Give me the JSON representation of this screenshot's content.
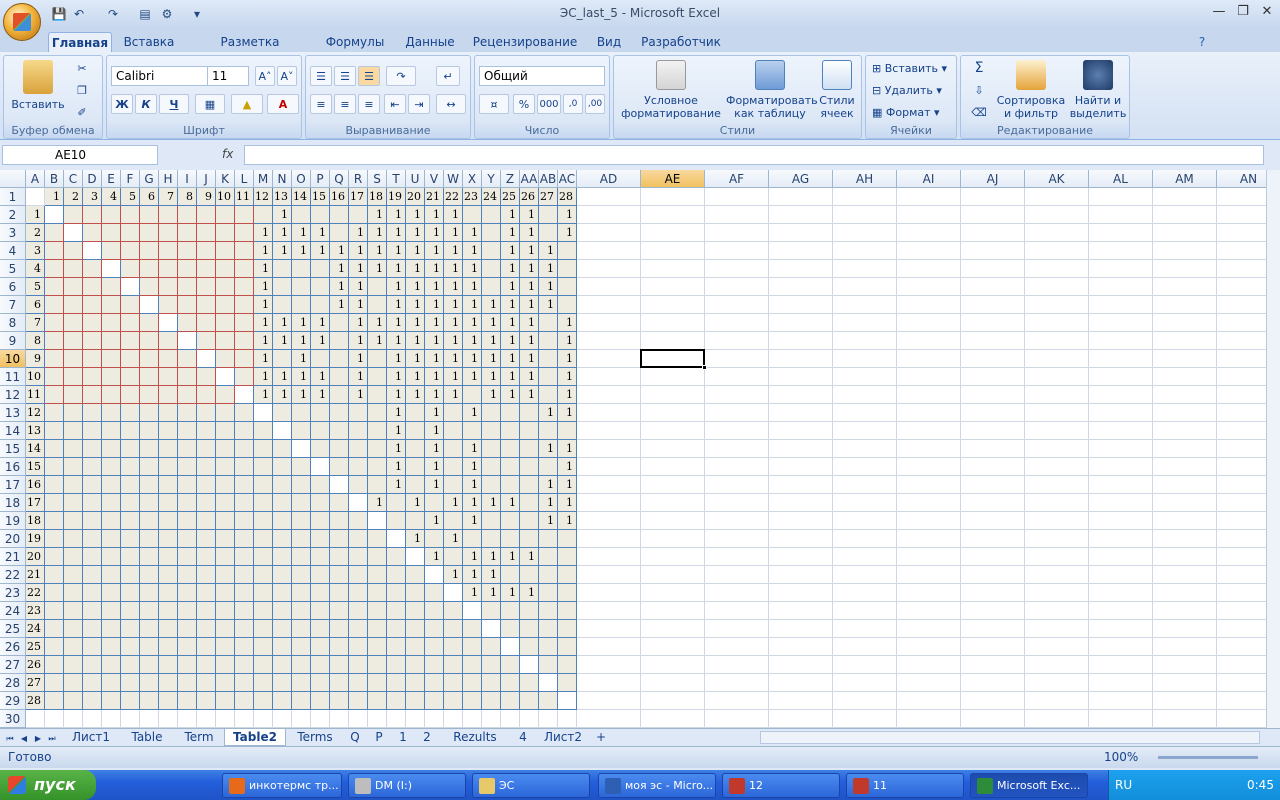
{
  "window": {
    "title": "ЭС_last_5 - Microsoft Excel"
  },
  "ribbon_tabs": [
    "Главная",
    "Вставка",
    "Разметка страницы",
    "Формулы",
    "Данные",
    "Рецензирование",
    "Вид",
    "Разработчик"
  ],
  "ribbon": {
    "paste_label": "Вставить",
    "clipboard_label": "Буфер обмена",
    "font_name": "Calibri",
    "font_size": "11",
    "bold": "Ж",
    "italic": "К",
    "underline": "Ч",
    "font_label": "Шрифт",
    "align_label": "Выравнивание",
    "number_format": "Общий",
    "number_label": "Число",
    "cond_format": "Условное форматирование",
    "format_table": "Форматировать как таблицу",
    "cell_styles": "Стили ячеек",
    "styles_label": "Стили",
    "insert": "Вставить",
    "delete": "Удалить",
    "format": "Формат",
    "cells_label": "Ячейки",
    "sort_filter": "Сортировка и фильтр",
    "find_select": "Найти и выделить",
    "editing_label": "Редактирование"
  },
  "formula_bar": {
    "name_box": "AE10",
    "fx": "fx",
    "formula": ""
  },
  "columns": [
    "A",
    "B",
    "C",
    "D",
    "E",
    "F",
    "G",
    "H",
    "I",
    "J",
    "K",
    "L",
    "M",
    "N",
    "O",
    "P",
    "Q",
    "R",
    "S",
    "T",
    "U",
    "V",
    "W",
    "X",
    "Y",
    "Z",
    "AA",
    "AB",
    "AC",
    "AD",
    "AE",
    "AF",
    "AG",
    "AH",
    "AI",
    "AJ",
    "AK",
    "AL",
    "AM",
    "AN"
  ],
  "row_numbers": [
    "1",
    "2",
    "3",
    "4",
    "5",
    "6",
    "7",
    "8",
    "9",
    "10",
    "11",
    "12",
    "13",
    "14",
    "15",
    "16",
    "17",
    "18",
    "19",
    "20",
    "21",
    "22",
    "23",
    "24",
    "25",
    "26",
    "27",
    "28",
    "29",
    "30"
  ],
  "grid": {
    "rows": [
      "1 2 3 4 5 6 7 8 9 10 11 12 13 14 15 16 17 18 19 20 21 22 23 24 25 26 27 28",
      "12:1|17:1|18:1|19:1|20:1|21:1|24:1|25:1|27:1",
      "11:1|12:1|13:1|14:1|16:1|17:1|18:1|19:1|20:1|21:1|22:1|24:1|25:1|27:1",
      "11:1|12:1|13:1|14:1|15:1|16:1|17:1|18:1|19:1|20:1|21:1|22:1|24:1|25:1|26:1",
      "11:1|15:1|16:1|17:1|18:1|19:1|20:1|21:1|22:1|24:1|25:1|26:1",
      "11:1|15:1|16:1|18:1|19:1|20:1|21:1|22:1|24:1|25:1|26:1",
      "11:1|15:1|16:1|18:1|19:1|20:1|21:1|22:1|23:1|24:1|25:1|26:1",
      "11:1|12:1|13:1|14:1|16:1|17:1|18:1|19:1|20:1|21:1|22:1|23:1|24:1|25:1|27:1",
      "11:1|12:1|13:1|14:1|16:1|17:1|18:1|19:1|20:1|21:1|22:1|23:1|24:1|25:1|27:1",
      "11:1|13:1|16:1|18:1|19:1|20:1|21:1|22:1|23:1|24:1|25:1|27:1",
      "11:1|12:1|13:1|14:1|16:1|18:1|19:1|20:1|21:1|22:1|23:1|24:1|25:1|27:1",
      "11:1|12:1|13:1|14:1|16:1|18:1|19:1|20:1|21:1|23:1|24:1|25:1|27:1",
      "18:1|20:1|22:1|26:1|27:1",
      "18:1|20:1",
      "18:1|20:1|22:1|26:1|27:1",
      "18:1|20:1|22:1|27:1",
      "18:1|20:1|22:1|26:1|27:1",
      "17:1|19:1|21:1|22:1|23:1|24:1|26:1|27:1",
      "20:1|22:1|26:1|27:1",
      "19:1|21:1",
      "20:1|22:1|23:1|24:1|25:1",
      "21:1|22:1|23:1",
      "22:1|23:1|24:1|25:1",
      "",
      "",
      "",
      "",
      ""
    ]
  },
  "sheet_tabs": [
    "Лист1",
    "Table",
    "Term",
    "Table2",
    "Terms",
    "Q",
    "P",
    "1",
    "2",
    "Rezults",
    "4",
    "Лист2"
  ],
  "active_sheet": "Table2",
  "status": {
    "ready": "Готово",
    "zoom": "100%"
  },
  "taskbar": {
    "start": "пуск",
    "items": [
      "инкотермс тр...",
      "DM (I:)",
      "ЭС",
      "моя эс - Micro...",
      "12",
      "11",
      "Microsoft Exc..."
    ],
    "lang": "RU",
    "time": "0:45"
  },
  "colors": {
    "accent": "#4f81bd",
    "diag": "#c0504d",
    "fill": "#eeece1",
    "selected_header": "#f1c15f"
  }
}
